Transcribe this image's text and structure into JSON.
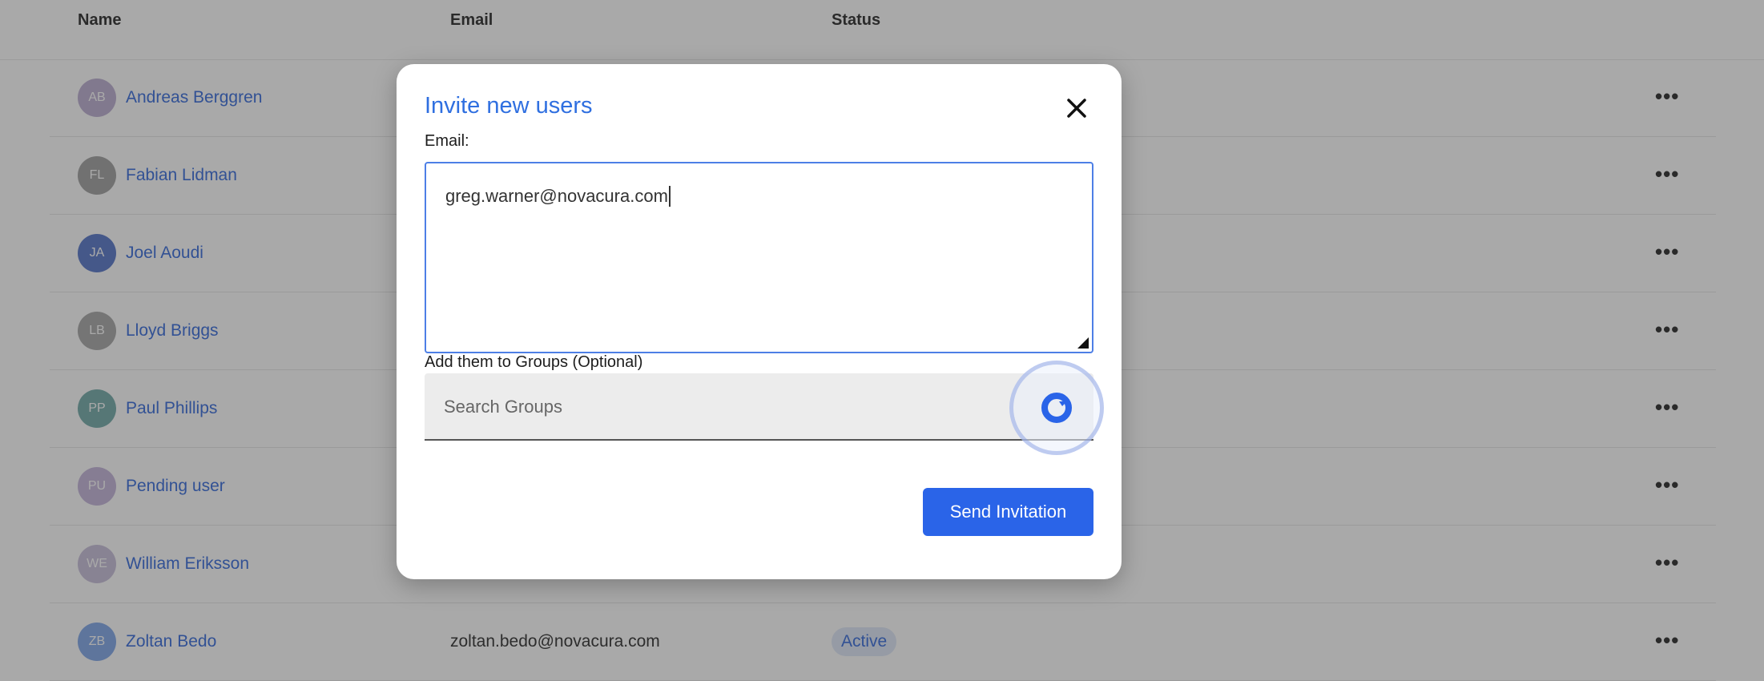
{
  "table": {
    "headers": {
      "name": "Name",
      "email": "Email",
      "status": "Status"
    },
    "rows": [
      {
        "initials": "AB",
        "name": "Andreas Berggren",
        "email": "",
        "status": "",
        "avatar_color": "#b8a9cf"
      },
      {
        "initials": "FL",
        "name": "Fabian Lidman",
        "email": "",
        "status": "",
        "avatar_color": "#9c9c9c"
      },
      {
        "initials": "JA",
        "name": "Joel Aoudi",
        "email": "",
        "status": "",
        "avatar_color": "#4e6fc7"
      },
      {
        "initials": "LB",
        "name": "Lloyd Briggs",
        "email": "",
        "status": "",
        "avatar_color": "#a3a3a3"
      },
      {
        "initials": "PP",
        "name": "Paul Phillips",
        "email": "",
        "status": "",
        "avatar_color": "#6ca6a4"
      },
      {
        "initials": "PU",
        "name": "Pending user",
        "email": "",
        "status": "",
        "avatar_color": "#c1b1d8"
      },
      {
        "initials": "WE",
        "name": "William Eriksson",
        "email": "",
        "status": "",
        "avatar_color": "#c5bbd8"
      },
      {
        "initials": "ZB",
        "name": "Zoltan Bedo",
        "email": "zoltan.bedo@novacura.com",
        "status": "Active",
        "avatar_color": "#7aa3e8"
      }
    ],
    "more_label": "•••"
  },
  "modal": {
    "title": "Invite new users",
    "email_label": "Email:",
    "email_value": "greg.warner@novacura.com",
    "groups_label": "Add them to Groups (Optional)",
    "groups_placeholder": "Search Groups",
    "send_label": "Send Invitation"
  },
  "colors": {
    "accent": "#2a64e8",
    "title": "#2f6fe0",
    "link": "#2b63d9"
  }
}
